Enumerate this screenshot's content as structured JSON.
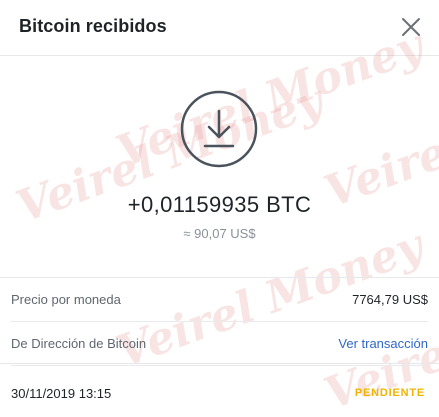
{
  "dialog": {
    "title": "Bitcoin recibidos",
    "close_icon": "close-icon"
  },
  "watermark": "Veirel Money",
  "transaction": {
    "icon": "download-arrow-icon",
    "amount": "+0,01159935 BTC",
    "fiat_amount": "≈ 90,07 US$"
  },
  "details": {
    "rows": [
      {
        "label": "Precio por moneda",
        "value": "7764,79 US$"
      },
      {
        "label": "De Dirección de Bitcoin",
        "value": "Ver transacción"
      }
    ]
  },
  "footer": {
    "timestamp": "30/11/2019 13:15",
    "status": "PENDIENTE"
  },
  "colors": {
    "status_pending": "#f0b400",
    "link": "#2f67c9",
    "icon_stroke": "#4a535c",
    "watermark": "#e28282"
  }
}
